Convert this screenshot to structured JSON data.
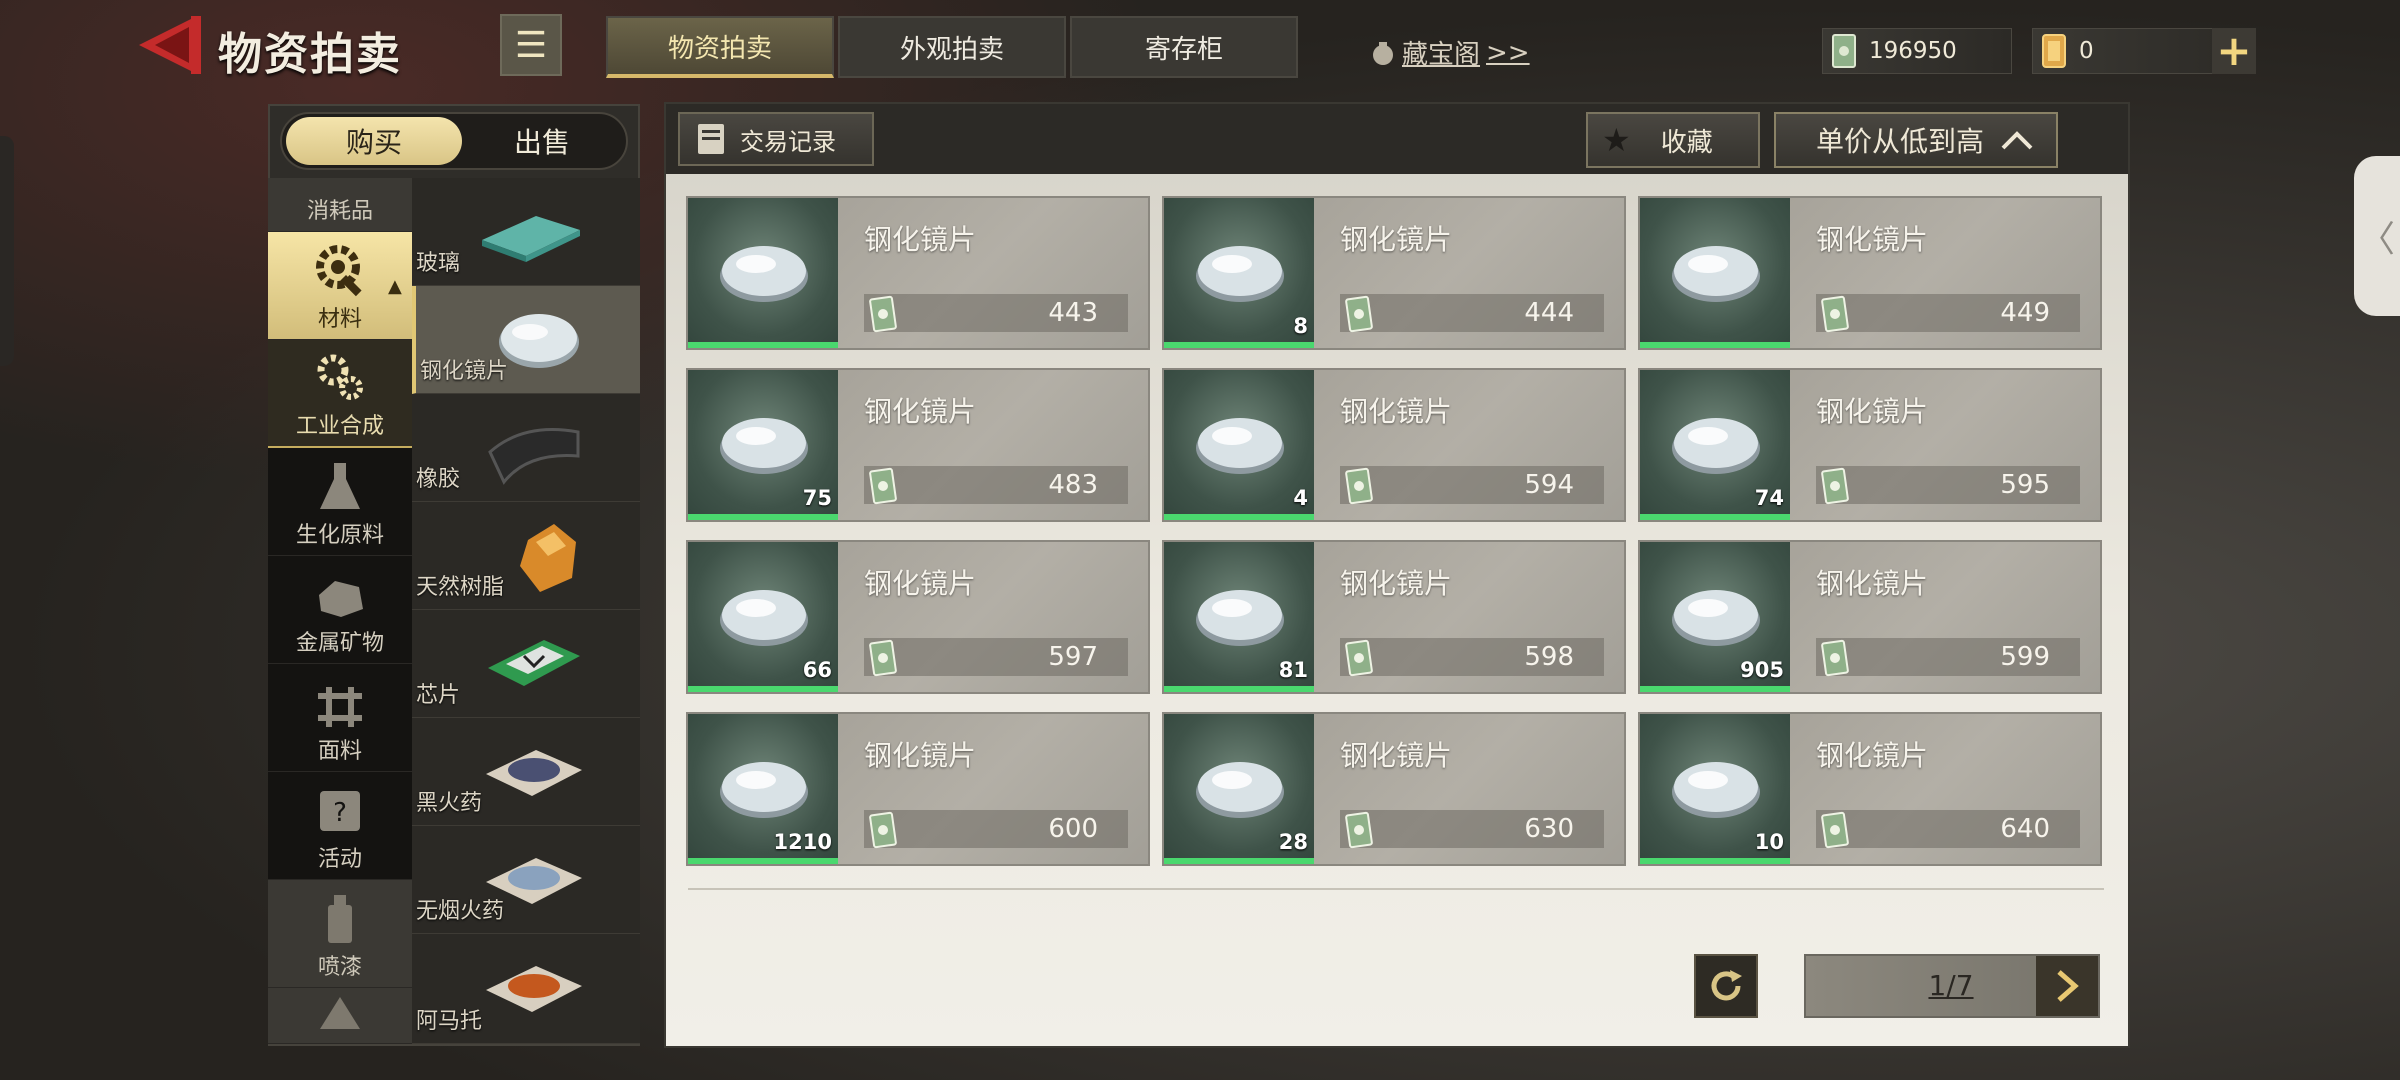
{
  "header": {
    "title": "物资拍卖",
    "tabs": [
      {
        "label": "物资拍卖",
        "active": true
      },
      {
        "label": "外观拍卖",
        "active": false
      },
      {
        "label": "寄存柜",
        "active": false
      }
    ],
    "treasure_link": "藏宝阁",
    "treasure_link_suffix": ">>",
    "currency": {
      "cash": "196950",
      "tickets": "0"
    },
    "add_button_icon": "plus-icon",
    "back_button_icon": "back-arrow-icon"
  },
  "sidebar": {
    "segment": {
      "buy": "购买",
      "sell": "出售",
      "selected": "buy"
    },
    "categories": [
      {
        "label": "消耗品",
        "icon": "consumable-icon"
      },
      {
        "label": "材料",
        "icon": "gear-wrench-icon",
        "selected": true
      },
      {
        "label": "工业合成",
        "icon": "gears-icon"
      },
      {
        "label": "生化原料",
        "icon": "flask-icon"
      },
      {
        "label": "金属矿物",
        "icon": "ore-icon"
      },
      {
        "label": "面料",
        "icon": "fabric-icon"
      },
      {
        "label": "活动",
        "icon": "event-icon"
      },
      {
        "label": "喷漆",
        "icon": "spray-can-icon"
      }
    ],
    "subcategories": [
      {
        "label": "玻璃"
      },
      {
        "label": "钢化镜片",
        "selected": true
      },
      {
        "label": "橡胶"
      },
      {
        "label": "天然树脂"
      },
      {
        "label": "芯片"
      },
      {
        "label": "黑火药"
      },
      {
        "label": "无烟火药"
      },
      {
        "label": "阿马托"
      }
    ]
  },
  "toolbar": {
    "trade_record": "交易记录",
    "favorite": "收藏",
    "sort": "单价从低到高"
  },
  "listings": [
    {
      "name": "钢化镜片",
      "qty": "",
      "price": "443"
    },
    {
      "name": "钢化镜片",
      "qty": "8",
      "price": "444"
    },
    {
      "name": "钢化镜片",
      "qty": "",
      "price": "449"
    },
    {
      "name": "钢化镜片",
      "qty": "75",
      "price": "483"
    },
    {
      "name": "钢化镜片",
      "qty": "4",
      "price": "594"
    },
    {
      "name": "钢化镜片",
      "qty": "74",
      "price": "595"
    },
    {
      "name": "钢化镜片",
      "qty": "66",
      "price": "597"
    },
    {
      "name": "钢化镜片",
      "qty": "81",
      "price": "598"
    },
    {
      "name": "钢化镜片",
      "qty": "905",
      "price": "599"
    },
    {
      "name": "钢化镜片",
      "qty": "1210",
      "price": "600"
    },
    {
      "name": "钢化镜片",
      "qty": "28",
      "price": "630"
    },
    {
      "name": "钢化镜片",
      "qty": "10",
      "price": "640"
    }
  ],
  "pagination": {
    "current_page": "1/7"
  },
  "colors": {
    "accent_gold": "#d9c586",
    "qty_bar_green": "#4ad86e",
    "panel_dark": "#2c2a26",
    "back_red": "#c42b2b"
  }
}
